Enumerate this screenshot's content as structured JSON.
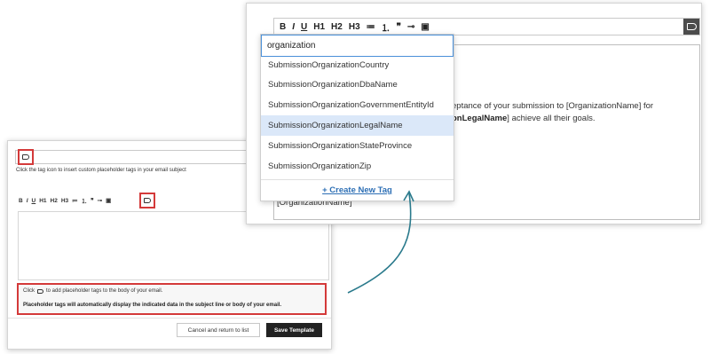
{
  "left_panel": {
    "subject_hint": "Click the tag icon to insert custom placeholder tags in your email subject",
    "toolbar": [
      "B",
      "I",
      "U",
      "H1",
      "H2",
      "H3",
      "≔",
      "⒈",
      "❞",
      "⊸",
      "▣"
    ],
    "hint_click": "Click",
    "hint_after": "to add placeholder tags to the body of your email.",
    "hint_bold": "Placeholder tags will automatically display the indicated data in the subject line or body of your email.",
    "cancel_label": "Cancel and return to list",
    "save_label": "Save Template",
    "highlight_color": "#d43a3a"
  },
  "right_panel": {
    "toolbar": [
      "B",
      "I",
      "U",
      "H1",
      "H2",
      "H3",
      "≔",
      "⒈",
      "❞",
      "⊸",
      "▣"
    ],
    "body_line1": "eptance of your submission to [OrganizationName] for",
    "body_line2_bold": "onLegalName",
    "body_line2_rest": "] achieve all their goals.",
    "body_line3": "[OrganizationName]",
    "dropdown": {
      "search_value": "organization",
      "items": [
        "SubmissionOrganizationCountry",
        "SubmissionOrganizationDbaName",
        "SubmissionOrganizationGovernmentEntityId",
        "SubmissionOrganizationLegalName",
        "SubmissionOrganizationStateProvince",
        "SubmissionOrganizationZip"
      ],
      "highlighted_index": 3,
      "create_label": "+ Create New Tag"
    }
  },
  "colors": {
    "arrow": "#2a7a8c",
    "link": "#2d6fb5",
    "highlight_row": "#dbe8f9"
  }
}
